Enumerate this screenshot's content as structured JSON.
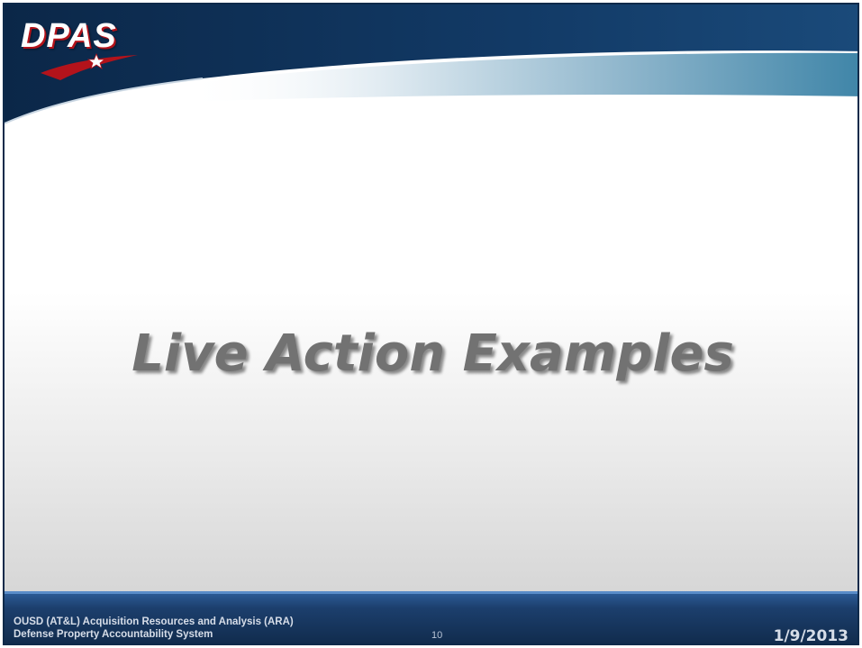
{
  "header": {
    "logo_text": "DPAS"
  },
  "slide": {
    "title": "Live Action Examples"
  },
  "footer": {
    "org_line1": "OUSD (AT&L) Acquisition Resources and Analysis (ARA)",
    "org_line2": "Defense Property Accountability System",
    "page_number": "10",
    "date": "1/9/2013"
  },
  "colors": {
    "brand_navy": "#0e2a4a",
    "brand_red": "#b3131b",
    "accent_teal": "#4a8fb0",
    "title_gray": "#727272"
  },
  "icons": [
    "dpas-logo-icon",
    "star-icon"
  ]
}
